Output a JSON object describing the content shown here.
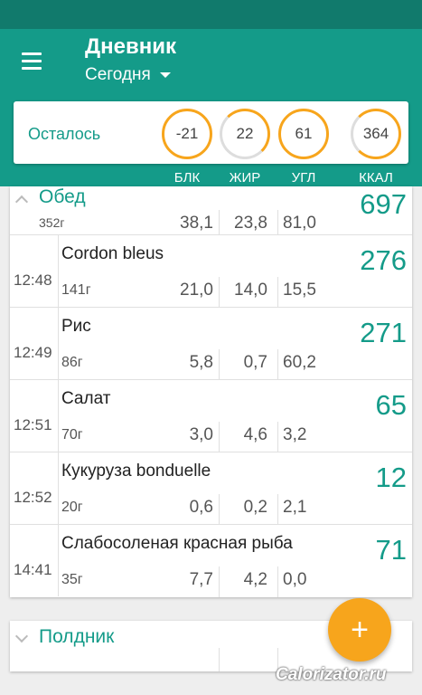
{
  "header": {
    "title": "Дневник",
    "date": "Сегодня"
  },
  "summary": {
    "label": "Осталось",
    "rings": [
      {
        "value": "-21",
        "fill": 1.0
      },
      {
        "value": "22",
        "fill": 0.6
      },
      {
        "value": "61",
        "fill": 0.85
      },
      {
        "value": "364",
        "fill": 0.75
      }
    ],
    "columns": [
      "БЛК",
      "ЖИР",
      "УГЛ",
      "ККАЛ"
    ]
  },
  "meals": [
    {
      "name": "Обед",
      "weight": "352г",
      "protein": "38,1",
      "fat": "23,8",
      "carbs": "81,0",
      "kcal": "697",
      "expanded": true,
      "entries": [
        {
          "time": "12:48",
          "name": "Cordon bleus",
          "weight": "141г",
          "protein": "21,0",
          "fat": "14,0",
          "carbs": "15,5",
          "kcal": "276"
        },
        {
          "time": "12:49",
          "name": "Рис",
          "weight": "86г",
          "protein": "5,8",
          "fat": "0,7",
          "carbs": "60,2",
          "kcal": "271"
        },
        {
          "time": "12:51",
          "name": "Салат",
          "weight": "70г",
          "protein": "3,0",
          "fat": "4,6",
          "carbs": "3,2",
          "kcal": "65"
        },
        {
          "time": "12:52",
          "name": "Кукуруза bonduelle",
          "weight": "20г",
          "protein": "0,6",
          "fat": "0,2",
          "carbs": "2,1",
          "kcal": "12"
        },
        {
          "time": "14:41",
          "name": "Слабосоленая красная рыба",
          "weight": "35г",
          "protein": "7,7",
          "fat": "4,2",
          "carbs": "0,0",
          "kcal": "71"
        }
      ]
    },
    {
      "name": "Полдник",
      "expanded": false
    }
  ],
  "fab": {
    "label": "+"
  },
  "watermark": "Calorizator.ru",
  "colors": {
    "primary": "#149b89",
    "primary_dark": "#117a6c",
    "accent": "#f7a51c"
  }
}
